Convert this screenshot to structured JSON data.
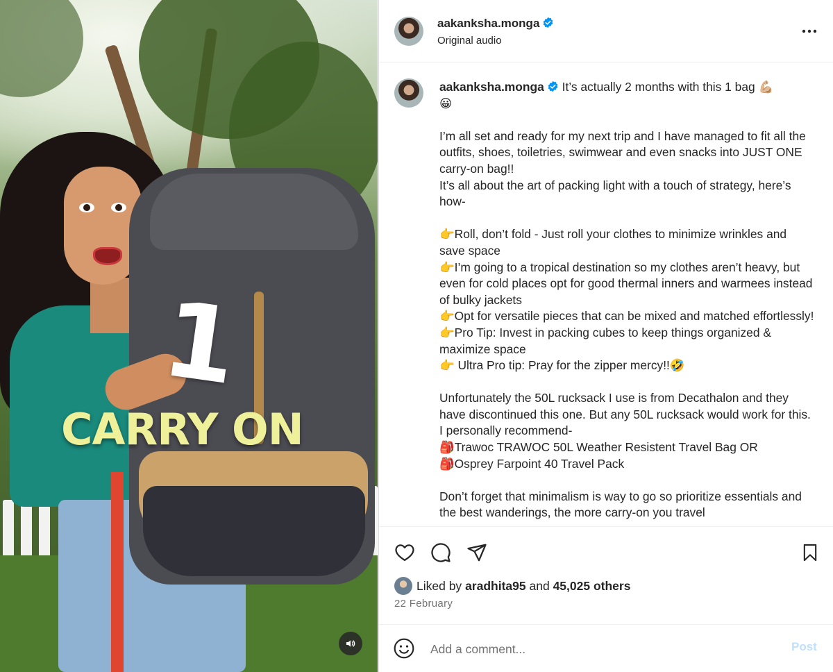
{
  "media": {
    "overlay_number": "1",
    "overlay_text": "CARRY ON",
    "sound_icon": "speaker-icon"
  },
  "header": {
    "username": "aakanksha.monga",
    "subtitle": "Original audio",
    "more_icon": "more-horizontal-icon"
  },
  "caption": {
    "username": "aakanksha.monga",
    "text": " It’s actually 2 months with this 1 bag 💪🏼\n😀\n\nI’m all set and ready for my next trip and I have managed to fit all the outfits, shoes, toiletries, swimwear and even snacks into JUST ONE carry-on bag!!\nIt’s all about the art of packing light with a touch of strategy, here’s how-\n\n👉Roll, don’t fold - Just roll your clothes to minimize wrinkles and save space\n👉I’m going to a tropical destination so my clothes aren’t heavy, but even for cold places opt for good thermal inners and warmees instead of bulky jackets\n👉Opt for versatile pieces that can be mixed and matched effortlessly!\n👉Pro Tip: Invest in packing cubes to keep things organized & maximize space\n👉 Ultra Pro tip: Pray for the zipper mercy!!🤣\n\nUnfortunately the 50L rucksack I use is from Decathalon and they have discontinued this one. But any 50L rucksack would work for this. I personally recommend-\n🎒Trawoc TRAWOC 50L Weather Resistent Travel Bag OR\n🎒Osprey Farpoint 40 Travel Pack\n\nDon’t forget that minimalism is way to go so prioritize essentials and the best wanderings, the more carry-on you travel"
  },
  "actions": {
    "like_icon": "heart-icon",
    "comment_icon": "comment-icon",
    "share_icon": "send-icon",
    "save_icon": "bookmark-icon",
    "liked_by_prefix": "Liked by",
    "liked_by_user": "aradhita95",
    "liked_by_and": "and",
    "liked_by_others": "45,025 others",
    "date": "22 February"
  },
  "comment": {
    "placeholder": "Add a comment...",
    "post_label": "Post",
    "emoji_icon": "smiley-icon"
  },
  "colors": {
    "verified_blue": "#0095f6",
    "post_disabled": "#c0dffd",
    "text_primary": "#262626",
    "text_secondary": "#737373"
  }
}
